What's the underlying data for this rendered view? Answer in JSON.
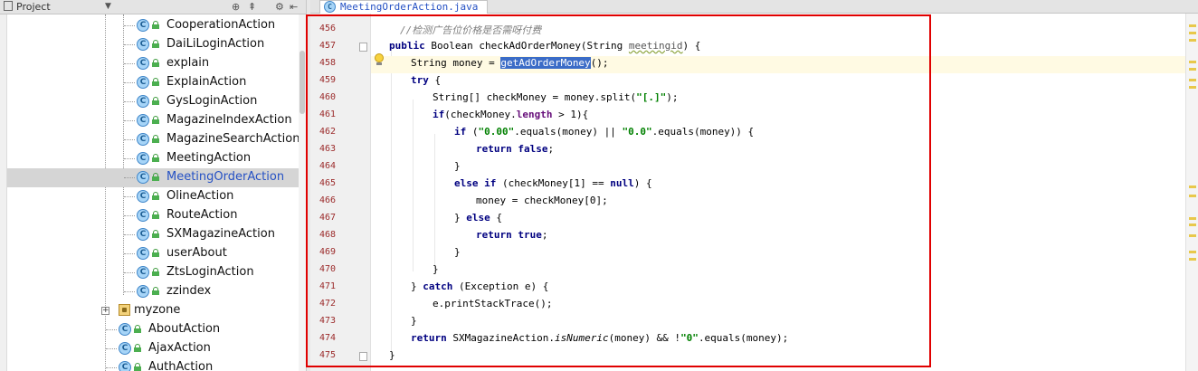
{
  "project_panel": {
    "title": "Project",
    "dropdown_icon": "chevron-down-icon",
    "toolbar_icons": [
      "target-icon",
      "collapse-icon",
      "gear-icon",
      "hide-icon"
    ],
    "items": [
      {
        "label": "CooperationAction",
        "type": "class"
      },
      {
        "label": "DaiLiLoginAction",
        "type": "class"
      },
      {
        "label": "explain",
        "type": "class"
      },
      {
        "label": "ExplainAction",
        "type": "class"
      },
      {
        "label": "GysLoginAction",
        "type": "class"
      },
      {
        "label": "MagazineIndexAction",
        "type": "class"
      },
      {
        "label": "MagazineSearchAction",
        "type": "class"
      },
      {
        "label": "MeetingAction",
        "type": "class"
      },
      {
        "label": "MeetingOrderAction",
        "type": "class",
        "selected": true
      },
      {
        "label": "OlineAction",
        "type": "class"
      },
      {
        "label": "RouteAction",
        "type": "class"
      },
      {
        "label": "SXMagazineAction",
        "type": "class"
      },
      {
        "label": "userAbout",
        "type": "class"
      },
      {
        "label": "ZtsLoginAction",
        "type": "class"
      },
      {
        "label": "zzindex",
        "type": "class"
      },
      {
        "label": "myzone",
        "type": "package"
      },
      {
        "label": "AboutAction",
        "type": "class2"
      },
      {
        "label": "AjaxAction",
        "type": "class2"
      },
      {
        "label": "AuthAction",
        "type": "class2"
      }
    ]
  },
  "editor": {
    "tab_label": "MeetingOrderAction.java",
    "line_numbers": [
      "456",
      "457",
      "458",
      "459",
      "460",
      "461",
      "462",
      "463",
      "464",
      "465",
      "466",
      "467",
      "468",
      "469",
      "470",
      "471",
      "472",
      "473",
      "474",
      "475"
    ],
    "colors": {
      "highlight_box": "#e00000",
      "keyword": "#000080",
      "string": "#008000",
      "line_number": "#9b2a2a"
    }
  }
}
